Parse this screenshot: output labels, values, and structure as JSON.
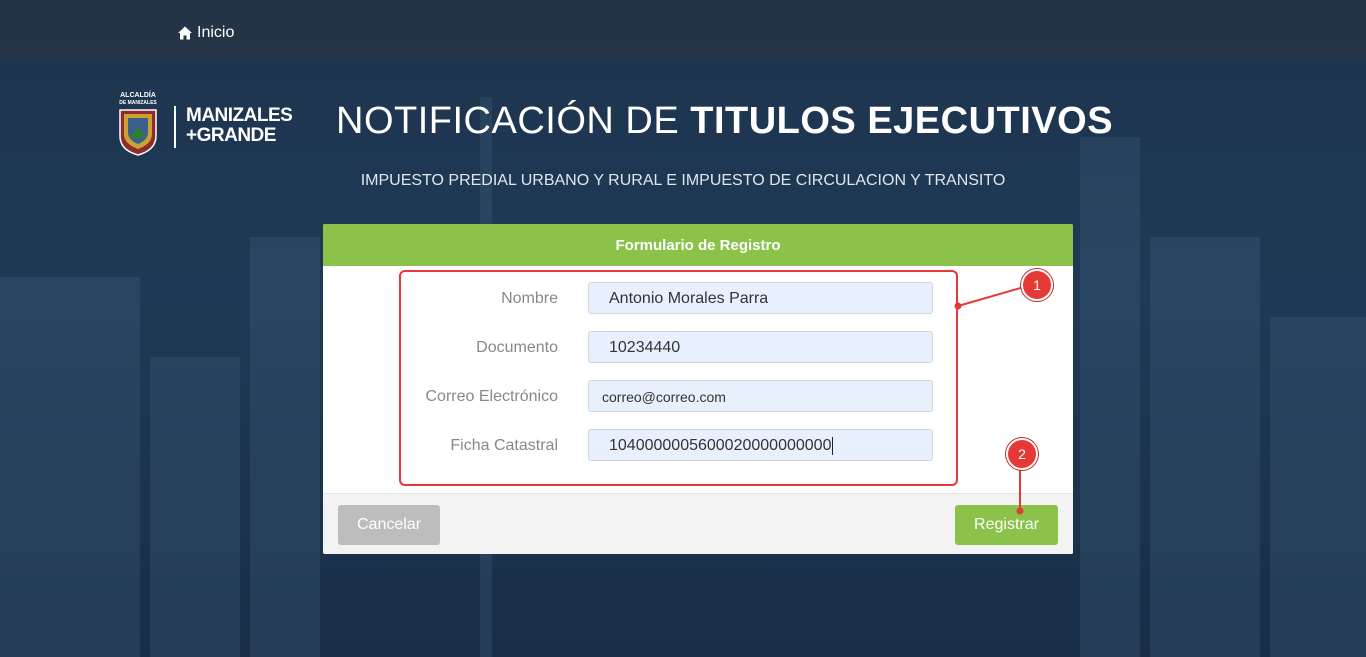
{
  "nav": {
    "home_label": "Inicio"
  },
  "logo": {
    "small_text_line1": "ALCALDÍA",
    "small_text_line2": "DE MANIZALES",
    "brand_line1": "MANIZALES",
    "brand_line2": "+GRANDE"
  },
  "header": {
    "title_light": "NOTIFICACIÓN DE ",
    "title_bold": "TITULOS EJECUTIVOS",
    "subtitle": "IMPUESTO PREDIAL URBANO Y RURAL E IMPUESTO DE CIRCULACION Y TRANSITO"
  },
  "form": {
    "title": "Formulario de Registro",
    "fields": [
      {
        "label": "Nombre",
        "value": "Antonio Morales Parra"
      },
      {
        "label": "Documento",
        "value": "10234440"
      },
      {
        "label": "Correo Electrónico",
        "value": "correo@correo.com"
      },
      {
        "label": "Ficha Catastral",
        "value": "1040000005600020000000000"
      }
    ],
    "cancel_label": "Cancelar",
    "submit_label": "Registrar"
  },
  "annotations": {
    "badge1": "1",
    "badge2": "2",
    "color": "#e53935"
  },
  "colors": {
    "accent": "#8bc34a",
    "cancel": "#bdbdbd"
  }
}
